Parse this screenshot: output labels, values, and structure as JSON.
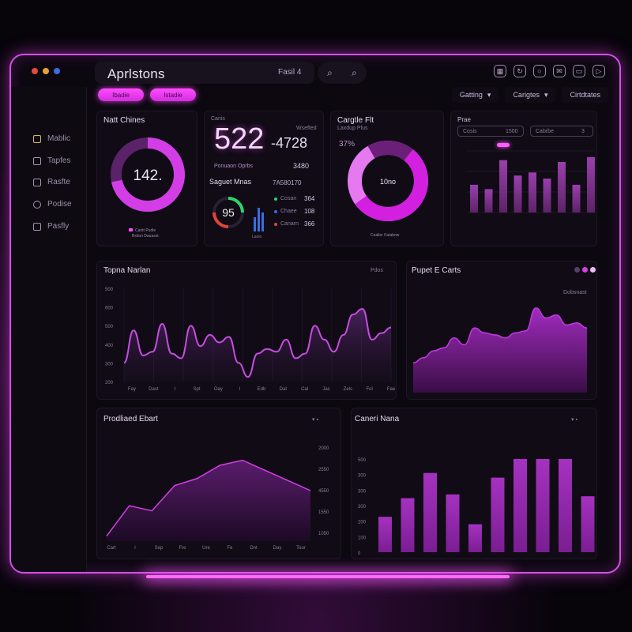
{
  "app": {
    "title": "Aprlstons"
  },
  "window_dots": [
    "#e24a3b",
    "#e6a13a",
    "#3b6fd8"
  ],
  "search": {
    "value": "Fasil  4"
  },
  "toolbar_icons": [
    "grid-icon",
    "refresh-icon",
    "circle-icon",
    "mail-icon",
    "chat-icon",
    "video-icon"
  ],
  "pills": [
    "Ibadie",
    "Istadie"
  ],
  "filters": [
    {
      "label": "Gatting",
      "arrow": "▾"
    },
    {
      "label": "Carigtes",
      "arrow": "▾"
    },
    {
      "label": "Cirtdtates",
      "arrow": ""
    }
  ],
  "sidebar": {
    "items": [
      {
        "label": "Mablic",
        "icon": "grid-icon"
      },
      {
        "label": "Tapfes",
        "icon": "table-icon"
      },
      {
        "label": "Rasfte",
        "icon": "image-icon"
      },
      {
        "label": "Podise",
        "icon": "search-icon"
      },
      {
        "label": "Pasfly",
        "icon": "file-icon"
      }
    ]
  },
  "card_donut1": {
    "title": "Natt Chines",
    "value": "142.",
    "legend1": "Cantt Pudle",
    "legend2": "Bxiton Dauasst"
  },
  "card_kpi": {
    "label": "Canis",
    "big": "522",
    "big2": "-4728",
    "right_label": "Wsefted",
    "sub": "Ponuaon Oprbs",
    "sub_value": "3480",
    "sub_title": "Saguet Mnas",
    "gauge": "95",
    "bars_label": "Laolo",
    "rows": [
      {
        "label": "Cosan",
        "value": "364"
      },
      {
        "label": "Chaee",
        "value": "108"
      },
      {
        "label": "Canarn",
        "value": "366"
      }
    ],
    "right_title": "7A580170"
  },
  "card_donut2": {
    "title": "Cargtle Flt",
    "sub": "Laxdup Plus",
    "pct": "37%",
    "center": "10no",
    "legend": "Cealler Fatabow"
  },
  "card_bars": {
    "title": "Prae",
    "tag1": "Cosis",
    "tag1_val": "1500",
    "tag2": "Cabrbe",
    "tag2_val": "3"
  },
  "chart_mid_left": {
    "title": "Topna Narlan",
    "legend": "Pdos"
  },
  "chart_mid_right": {
    "title": "Pupet E Carts",
    "legend": "Dobsnast"
  },
  "chart_bot_left": {
    "title": "Prodliaed Ebart"
  },
  "chart_bot_right": {
    "title": "Caneri Nana"
  },
  "chart_data": [
    {
      "type": "line",
      "title": "Topna Narlan",
      "ylabels": [
        "500",
        "600",
        "500",
        "400",
        "300",
        "200"
      ],
      "xlabels": [
        "Fay",
        "Dast",
        "I",
        "Spt",
        "Oay",
        "I",
        "Edb",
        "Dat",
        "Cal",
        "Jas",
        "Zels",
        "Fol",
        "Fae"
      ],
      "values": [
        0.2,
        0.55,
        0.28,
        0.32,
        0.62,
        0.3,
        0.25,
        0.6,
        0.38,
        0.5,
        0.42,
        0.48,
        0.2,
        0.05,
        0.3,
        0.35,
        0.32,
        0.45,
        0.25,
        0.3,
        0.6,
        0.45,
        0.32,
        0.5,
        0.72,
        0.78,
        0.45,
        0.52,
        0.58
      ]
    },
    {
      "type": "area",
      "title": "Pupet E Carts",
      "values": [
        0.3,
        0.35,
        0.42,
        0.45,
        0.55,
        0.48,
        0.65,
        0.6,
        0.58,
        0.55,
        0.6,
        0.62,
        0.85,
        0.75,
        0.78,
        0.68,
        0.7,
        0.65
      ]
    },
    {
      "type": "area",
      "title": "Prodliaed Ebart",
      "ylabels": [
        "2000",
        "2550",
        "4550",
        "1550",
        "1050"
      ],
      "xlabels": [
        "Cart",
        "I",
        "Sep",
        "Fre",
        "Ure",
        "Fe",
        "Dnt",
        "Day",
        "Tour"
      ],
      "values": [
        0.05,
        0.35,
        0.3,
        0.55,
        0.62,
        0.75,
        0.8,
        0.7,
        0.6,
        0.5
      ]
    },
    {
      "type": "bar",
      "title": "Caneri Nana",
      "ylabels": [
        "500",
        "300",
        "300",
        "300",
        "200",
        "100",
        "0"
      ],
      "values": [
        0.38,
        0.58,
        0.85,
        0.62,
        0.3,
        0.8,
        1.0,
        1.0,
        1.0,
        0.6
      ]
    },
    {
      "type": "bar",
      "title": "Prae",
      "values": [
        0.45,
        0.38,
        0.85,
        0.6,
        0.65,
        0.55,
        0.82,
        0.45,
        0.9
      ]
    }
  ]
}
